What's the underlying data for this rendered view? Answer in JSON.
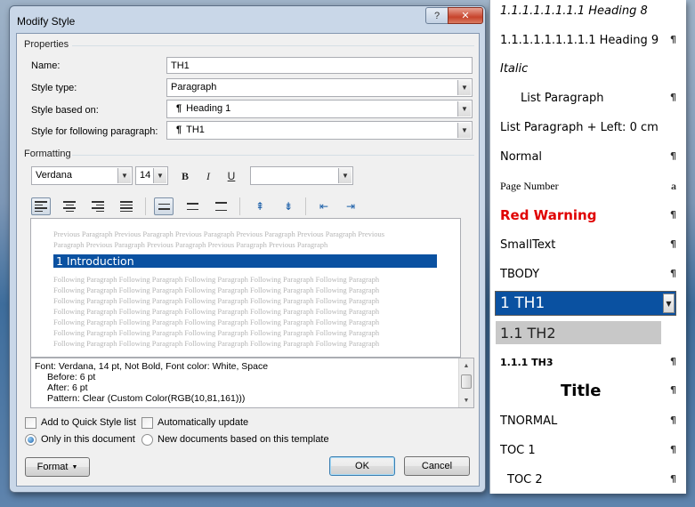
{
  "dialog": {
    "title": "Modify Style",
    "help_glyph": "?",
    "close_glyph": "✕",
    "properties": {
      "section": "Properties",
      "name_label": "Name:",
      "name_value": "TH1",
      "type_label": "Style type:",
      "type_value": "Paragraph",
      "based_label": "Style based on:",
      "based_value": "Heading 1",
      "following_label": "Style for following paragraph:",
      "following_value": "TH1"
    },
    "formatting": {
      "section": "Formatting",
      "font": "Verdana",
      "size": "14",
      "bold": "B",
      "italic": "I",
      "underline": "U",
      "color": ""
    },
    "preview": {
      "previous_lines": [
        "Previous Paragraph Previous Paragraph Previous Paragraph Previous Paragraph Previous Paragraph Previous",
        "Paragraph Previous Paragraph Previous Paragraph Previous Paragraph Previous Paragraph"
      ],
      "heading": "1   Introduction",
      "following_lines": [
        "Following Paragraph Following Paragraph Following Paragraph Following Paragraph Following Paragraph",
        "Following Paragraph Following Paragraph Following Paragraph Following Paragraph Following Paragraph",
        "Following Paragraph Following Paragraph Following Paragraph Following Paragraph Following Paragraph",
        "Following Paragraph Following Paragraph Following Paragraph Following Paragraph Following Paragraph",
        "Following Paragraph Following Paragraph Following Paragraph Following Paragraph Following Paragraph",
        "Following Paragraph Following Paragraph Following Paragraph Following Paragraph Following Paragraph",
        "Following Paragraph Following Paragraph Following Paragraph Following Paragraph Following Paragraph"
      ]
    },
    "description": [
      "Font: Verdana, 14 pt, Not Bold, Font color: White, Space",
      "Before:  6 pt",
      "After:  6 pt",
      "Pattern: Clear (Custom Color(RGB(10,81,161)))"
    ],
    "options": {
      "add_quick": "Add to Quick Style list",
      "auto_update": "Automatically update",
      "only_doc": "Only in this document",
      "new_docs": "New documents based on this template"
    },
    "buttons": {
      "format": "Format",
      "ok": "OK",
      "cancel": "Cancel"
    }
  },
  "styles_pane": {
    "items": [
      {
        "label": "1.1.1.1.1.1.1.1  Heading 8",
        "marker": "",
        "style": "italic-top"
      },
      {
        "label": "1.1.1.1.1.1.1.1.1  Heading 9",
        "marker": "¶",
        "style": "normal"
      },
      {
        "label": "Italic",
        "marker": "",
        "style": "italic"
      },
      {
        "label": "List Paragraph",
        "marker": "¶",
        "style": "indent"
      },
      {
        "label": "List Paragraph + Left:  0 cm",
        "marker": "",
        "style": "normal"
      },
      {
        "label": "Normal",
        "marker": "¶",
        "style": "normal"
      },
      {
        "label": "Page Number",
        "marker": "a",
        "style": "serif-small"
      },
      {
        "label": "Red Warning",
        "marker": "¶",
        "style": "red"
      },
      {
        "label": "SmallText",
        "marker": "¶",
        "style": "normal"
      },
      {
        "label": "TBODY",
        "marker": "¶",
        "style": "normal"
      },
      {
        "label": "1   TH1",
        "marker": "",
        "style": "selected"
      },
      {
        "label": "1.1   TH2",
        "marker": "",
        "style": "hover"
      },
      {
        "label": "1.1.1   TH3",
        "marker": "¶",
        "style": "th3"
      },
      {
        "label": "Title",
        "marker": "¶",
        "style": "title"
      },
      {
        "label": "TNORMAL",
        "marker": "¶",
        "style": "normal"
      },
      {
        "label": "TOC 1",
        "marker": "¶",
        "style": "normal"
      },
      {
        "label": "TOC 2",
        "marker": "¶",
        "style": "toc2"
      }
    ]
  },
  "colors": {
    "accent": "#0a51a1",
    "warning": "#e00000"
  }
}
